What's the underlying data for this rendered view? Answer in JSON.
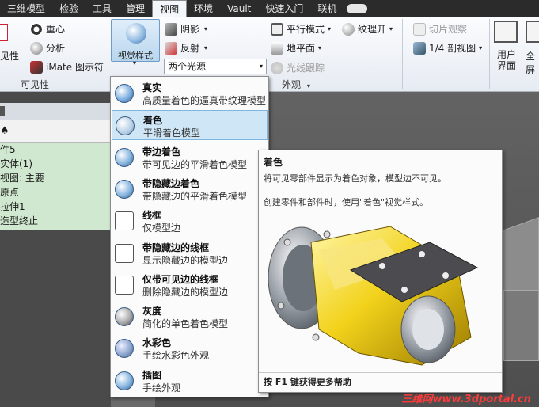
{
  "tabs": [
    "三维模型",
    "检验",
    "工具",
    "管理",
    "视图",
    "环境",
    "Vault",
    "快速入门",
    "联机"
  ],
  "ribbon": {
    "visibility_left_label": "见性",
    "center_of_gravity": "重心",
    "analysis": "分析",
    "imate": "iMate 图示符",
    "panel_visibility": "可见性",
    "visual_style": "视觉样式",
    "shadow": "阴影",
    "reflection": "反射",
    "lighting": "两个光源",
    "parallel_mode": "平行模式",
    "texture_on": "纹理开",
    "ground_plane": "地平面",
    "quarter_section": "1/4 剖视图",
    "raytracing": "光线跟踪",
    "slice": "切片观察",
    "user_interface": "用户界面",
    "fullscreen": "全屏",
    "panel_appearance": "外观"
  },
  "tree": {
    "items": [
      "件5",
      "实体(1)",
      "视图: 主要",
      "原点",
      "拉伸1",
      "造型终止"
    ]
  },
  "dropdown": {
    "items": [
      {
        "title": "真实",
        "desc": "高质量着色的逼真带纹理模型"
      },
      {
        "title": "着色",
        "desc": "平滑着色模型"
      },
      {
        "title": "带边着色",
        "desc": "带可见边的平滑着色模型"
      },
      {
        "title": "带隐藏边着色",
        "desc": "带隐藏边的平滑着色模型"
      },
      {
        "title": "线框",
        "desc": "仅模型边"
      },
      {
        "title": "带隐藏边的线框",
        "desc": "显示隐藏边的模型边"
      },
      {
        "title": "仅带可见边的线框",
        "desc": "删除隐藏边的模型边"
      },
      {
        "title": "灰度",
        "desc": "简化的单色着色模型"
      },
      {
        "title": "水彩色",
        "desc": "手绘水彩色外观"
      },
      {
        "title": "插图",
        "desc": "手绘外观"
      }
    ],
    "selected": 1
  },
  "tooltip": {
    "title": "着色",
    "line1": "将可见零部件显示为着色对象，模型边不可见。",
    "line2": "创建零件和部件时，使用\"着色\"视觉样式。",
    "footer": "按 F1 键获得更多帮助"
  },
  "watermark": "三维网www.3dportal.cn",
  "colors": {
    "accent": "#cfe6f6",
    "part_yellow": "#f2d21b",
    "watermark": "#ff3a3a"
  }
}
